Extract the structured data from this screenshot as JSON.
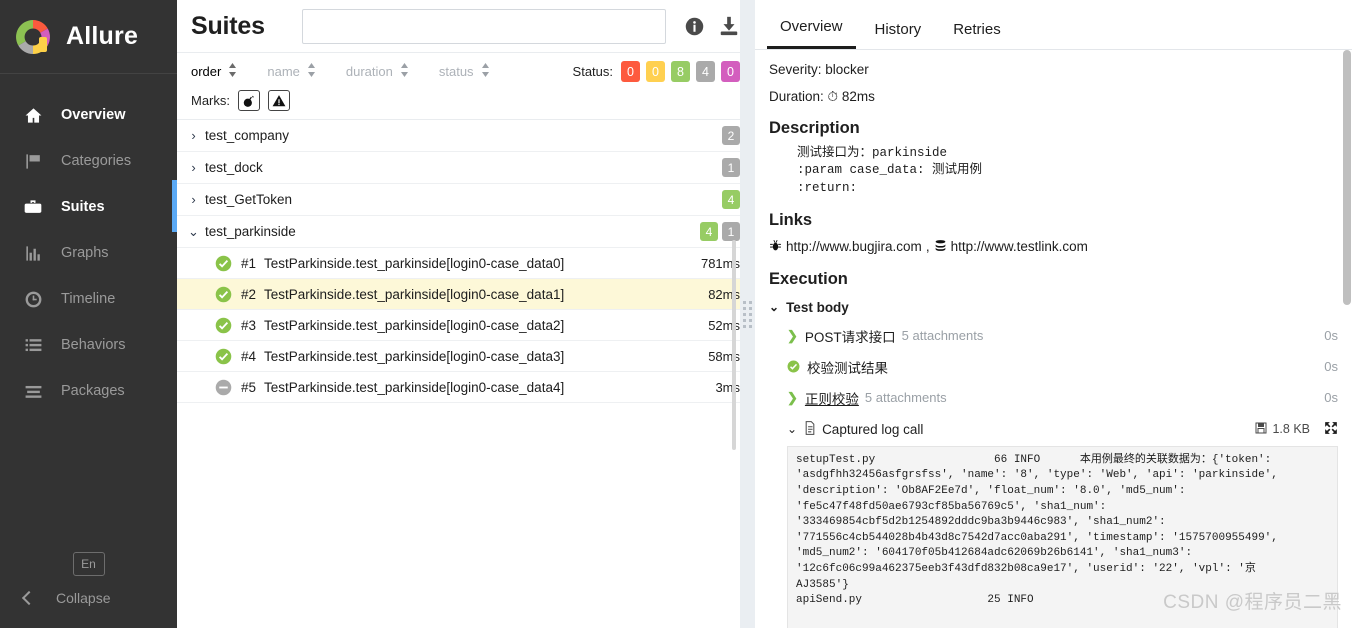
{
  "sidebar": {
    "brand": "Allure",
    "items": [
      {
        "label": "Overview",
        "icon": "home-icon"
      },
      {
        "label": "Categories",
        "icon": "flag-icon"
      },
      {
        "label": "Suites",
        "icon": "briefcase-icon"
      },
      {
        "label": "Graphs",
        "icon": "bar-chart-icon"
      },
      {
        "label": "Timeline",
        "icon": "clock-icon"
      },
      {
        "label": "Behaviors",
        "icon": "list-icon"
      },
      {
        "label": "Packages",
        "icon": "stack-icon"
      }
    ],
    "active": "Suites",
    "language": "En",
    "collapse": "Collapse"
  },
  "suites": {
    "title": "Suites",
    "search_value": "",
    "search_placeholder": "",
    "sort": {
      "options": [
        {
          "label": "order",
          "active": true
        },
        {
          "label": "name",
          "active": false
        },
        {
          "label": "duration",
          "active": false
        },
        {
          "label": "status",
          "active": false
        }
      ]
    },
    "status": {
      "label": "Status:",
      "counts": [
        {
          "value": "0",
          "color": "#fd5a3e",
          "name": "failed"
        },
        {
          "value": "0",
          "color": "#ffd050",
          "name": "broken"
        },
        {
          "value": "8",
          "color": "#97cc64",
          "name": "passed"
        },
        {
          "value": "4",
          "color": "#aaaaaa",
          "name": "skipped"
        },
        {
          "value": "0",
          "color": "#d35ebe",
          "name": "unknown"
        }
      ]
    },
    "marks": {
      "label": "Marks:",
      "buttons": [
        "bomb-icon",
        "warning-icon"
      ]
    },
    "tree": [
      {
        "name": "test_company",
        "expanded": false,
        "badges": [
          {
            "value": "2",
            "color": "#aaaaaa"
          }
        ]
      },
      {
        "name": "test_dock",
        "expanded": false,
        "badges": [
          {
            "value": "1",
            "color": "#aaaaaa"
          }
        ]
      },
      {
        "name": "test_GetToken",
        "expanded": false,
        "badges": [
          {
            "value": "4",
            "color": "#97cc64"
          }
        ]
      },
      {
        "name": "test_parkinside",
        "expanded": true,
        "badges": [
          {
            "value": "4",
            "color": "#97cc64"
          },
          {
            "value": "1",
            "color": "#aaaaaa"
          }
        ]
      }
    ],
    "tests": [
      {
        "num": "#1",
        "name": "TestParkinside.test_parkinside[login0-case_data0]",
        "duration": "781ms",
        "status": "passed",
        "selected": false
      },
      {
        "num": "#2",
        "name": "TestParkinside.test_parkinside[login0-case_data1]",
        "duration": "82ms",
        "status": "passed",
        "selected": true
      },
      {
        "num": "#3",
        "name": "TestParkinside.test_parkinside[login0-case_data2]",
        "duration": "52ms",
        "status": "passed",
        "selected": false
      },
      {
        "num": "#4",
        "name": "TestParkinside.test_parkinside[login0-case_data3]",
        "duration": "58ms",
        "status": "passed",
        "selected": false
      },
      {
        "num": "#5",
        "name": "TestParkinside.test_parkinside[login0-case_data4]",
        "duration": "3ms",
        "status": "skipped",
        "selected": false
      }
    ]
  },
  "detail": {
    "tabs": [
      {
        "label": "Overview",
        "active": true
      },
      {
        "label": "History",
        "active": false
      },
      {
        "label": "Retries",
        "active": false
      }
    ],
    "severity": "Severity: blocker",
    "duration_label": "Duration:",
    "duration_value": "82ms",
    "description_title": "Description",
    "description_text": "测试接口为：parkinside\n:param case_data: 测试用例\n:return:",
    "links_title": "Links",
    "links": [
      {
        "icon": "bug-icon",
        "url": "http://www.bugjira.com"
      },
      {
        "icon": "layers-icon",
        "url": "http://www.testlink.com"
      }
    ],
    "links_separator": ",",
    "execution_title": "Execution",
    "test_body_label": "Test body",
    "steps": [
      {
        "name": "POST请求接口",
        "attachments": "5 attachments",
        "time": "0s",
        "status": "step",
        "underline": false
      },
      {
        "name": "校验测试结果",
        "attachments": "",
        "time": "0s",
        "status": "passed",
        "underline": false
      },
      {
        "name": "正则校验",
        "attachments": "5 attachments",
        "time": "0s",
        "status": "step",
        "underline": true
      }
    ],
    "log": {
      "title": "Captured log call",
      "size": "1.8 KB",
      "text": "setupTest.py                  66 INFO      本用例最终的关联数据为：{'token':\n'asdgfhh32456asfgrsfss', 'name': '8', 'type': 'Web', 'api': 'parkinside',\n'description': 'Ob8AF2Ee7d', 'float_num': '8.0', 'md5_num':\n'fe5c47f48fd50ae6793cf85ba56769c5', 'sha1_num':\n'333469854cbf5d2b1254892dddc9ba3b9446c983', 'sha1_num2':\n'771556c4cb544028b4b43d8c7542d7acc0aba291', 'timestamp': '1575700955499',\n'md5_num2': '604170f05b412684adc62069b26b6141', 'sha1_num3':\n'12c6fc06c99a462375eeb3f43dfd832b08ca9e17', 'userid': '22', 'vpl': '京\nAJ3585'}\napiSend.py                   25 INFO"
    },
    "watermark": "CSDN @程序员二黑"
  }
}
